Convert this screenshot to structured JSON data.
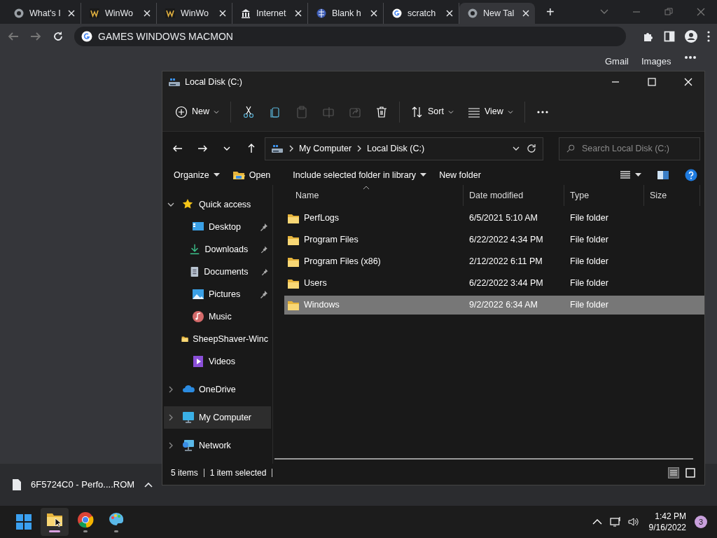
{
  "browser": {
    "tabs": [
      {
        "label": "What's I",
        "kind": "chrome",
        "selected": false
      },
      {
        "label": "WinWo",
        "kind": "winworld",
        "selected": false
      },
      {
        "label": "WinWo",
        "kind": "winworld",
        "selected": false
      },
      {
        "label": "Internet",
        "kind": "museum",
        "selected": false
      },
      {
        "label": "Blank h",
        "kind": "globe",
        "selected": false
      },
      {
        "label": "scratch",
        "kind": "google",
        "selected": false
      },
      {
        "label": "New Tal",
        "kind": "chrome",
        "selected": true
      }
    ],
    "new_tab": "+",
    "address": "GAMES WINDOWS MACMON",
    "page_links": [
      "Gmail",
      "Images"
    ]
  },
  "explorer": {
    "title": "Local Disk (C:)",
    "commands": [
      {
        "label": "New",
        "kind": "new",
        "disabled": false
      },
      {
        "kind": "cut",
        "disabled": false
      },
      {
        "kind": "copy",
        "disabled": false
      },
      {
        "kind": "paste",
        "disabled": true
      },
      {
        "kind": "rename",
        "disabled": true
      },
      {
        "kind": "share",
        "disabled": true
      },
      {
        "kind": "delete",
        "disabled": false
      },
      {
        "label": "Sort",
        "kind": "sort",
        "disabled": false
      },
      {
        "label": "View",
        "kind": "view",
        "disabled": false
      },
      {
        "kind": "more",
        "disabled": false
      }
    ],
    "breadcrumb": [
      "My Computer",
      "Local Disk (C:)"
    ],
    "search": {
      "placeholder": "Search Local Disk (C:)"
    },
    "menu": [
      {
        "label": "Organize",
        "dropdown": true
      },
      {
        "label": "Open",
        "dropdown": false
      },
      {
        "label": "Include selected folder in library",
        "dropdown": true
      },
      {
        "label": "New folder",
        "dropdown": false
      }
    ],
    "nav": [
      {
        "label": "Quick access",
        "kind": "star",
        "expanded": true,
        "selected": false,
        "children": [
          {
            "label": "Desktop",
            "kind": "desktop",
            "pinned": true
          },
          {
            "label": "Downloads",
            "kind": "download",
            "pinned": true
          },
          {
            "label": "Documents",
            "kind": "document",
            "pinned": true
          },
          {
            "label": "Pictures",
            "kind": "picture",
            "pinned": true
          },
          {
            "label": "Music",
            "kind": "music",
            "pinned": false
          },
          {
            "label": "SheepShaver-Winc",
            "kind": "folder",
            "pinned": false
          },
          {
            "label": "Videos",
            "kind": "video",
            "pinned": false
          }
        ]
      },
      {
        "label": "OneDrive",
        "kind": "cloud",
        "expanded": false,
        "selected": false
      },
      {
        "label": "My Computer",
        "kind": "computer",
        "expanded": false,
        "selected": true
      },
      {
        "label": "Network",
        "kind": "network",
        "expanded": false,
        "selected": false
      }
    ],
    "columns": [
      "Name",
      "Date modified",
      "Type",
      "Size"
    ],
    "rows": [
      {
        "name": "PerfLogs",
        "date": "6/5/2021 5:10 AM",
        "type": "File folder",
        "selected": false
      },
      {
        "name": "Program Files",
        "date": "6/22/2022 4:34 PM",
        "type": "File folder",
        "selected": false
      },
      {
        "name": "Program Files (x86)",
        "date": "2/12/2022 6:11 PM",
        "type": "File folder",
        "selected": false
      },
      {
        "name": "Users",
        "date": "6/22/2022 3:44 PM",
        "type": "File folder",
        "selected": false
      },
      {
        "name": "Windows",
        "date": "9/2/2022 6:34 AM",
        "type": "File folder",
        "selected": true
      }
    ],
    "status": [
      "5 items",
      "1 item selected"
    ]
  },
  "download_shelf": {
    "file": "6F5724C0 - Perfo....ROM"
  },
  "taskbar": {
    "apps": [
      {
        "kind": "start",
        "active": false
      },
      {
        "kind": "explorer",
        "active": true
      },
      {
        "kind": "chrome",
        "active": false
      },
      {
        "kind": "paint",
        "active": false
      }
    ],
    "time": "1:42 PM",
    "date": "9/16/2022",
    "notifications": "3"
  }
}
